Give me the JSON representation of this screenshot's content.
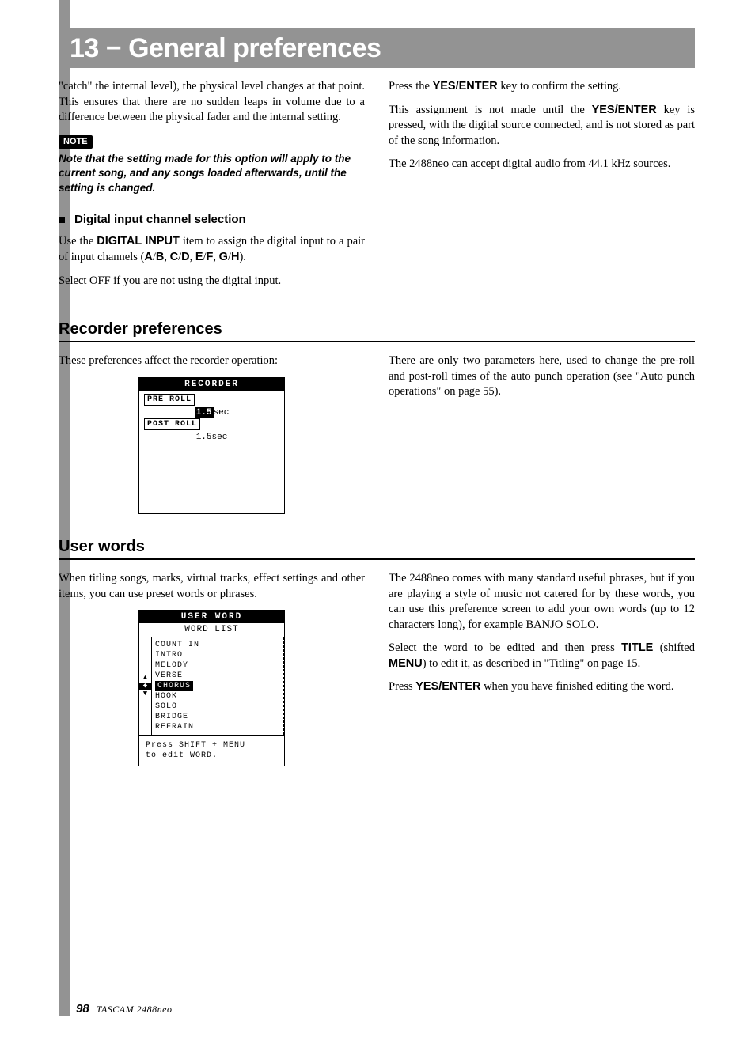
{
  "header": {
    "title": "13 − General preferences"
  },
  "leftcol": {
    "intro_p": "\"catch\" the internal level), the physical level changes at that point. This ensures that there are no sudden leaps in volume due to a difference between the physical fader and the internal setting.",
    "note_label": "NOTE",
    "note_body": "Note that the setting made for this option will apply to the current song, and any songs loaded afterwards, until the setting is changed.",
    "digital_head": "Digital input channel selection",
    "digital_p1a": "Use the ",
    "digital_p1b": "DIGITAL INPUT",
    "digital_p1c": " item to assign the digital input to a pair of input channels (",
    "digital_p1d": "A",
    "digital_p1e": "/",
    "digital_p1f": "B",
    "digital_p1g": ", ",
    "digital_p1h": "C",
    "digital_p1i": "/",
    "digital_p1j": "D",
    "digital_p1k": ", ",
    "digital_p1l": "E",
    "digital_p1m": "/",
    "digital_p1n": "F",
    "digital_p1o": ", ",
    "digital_p1p": "G",
    "digital_p1q": "/",
    "digital_p1r": "H",
    "digital_p1s": ").",
    "digital_p2": "Select OFF if you are not using the digital input."
  },
  "rightcol": {
    "p1a": "Press the ",
    "p1b": "YES/ENTER",
    "p1c": " key to confirm the setting.",
    "p2a": "This assignment is not made until the ",
    "p2b": "YES/ENTER",
    "p2c": " key is pressed, with the digital source connected, and is not stored as part of the song information.",
    "p3": "The 2488neo can accept digital audio from 44.1 kHz sources."
  },
  "recorder": {
    "heading": "Recorder preferences",
    "left_intro": "These preferences affect the recorder operation:",
    "right_p": "There are only two parameters here, used to change the pre-roll and post-roll times of the auto punch operation (see \"Auto punch operations\" on page 55).",
    "lcd": {
      "title": "RECORDER",
      "pre_label": "PRE ROLL",
      "pre_value_hi": "1.5",
      "pre_value_suffix": "sec",
      "post_label": "POST ROLL",
      "post_value": "1.5sec"
    }
  },
  "userwords": {
    "heading": "User words",
    "left_intro": "When titling songs, marks, virtual tracks, effect settings and other items, you can use preset words or phrases.",
    "right_p1": "The 2488neo comes with many standard useful phrases, but if you are playing a style of music not catered for by these words, you can use this preference screen to add your own words (up to 12 characters long), for example BANJO SOLO.",
    "right_p2a": "Select the word to be edited and then press ",
    "right_p2b": "TITLE",
    "right_p2c": " (shifted ",
    "right_p2d": "MENU",
    "right_p2e": ") to edit it, as described in \"Titling\" on page 15.",
    "right_p3a": "Press ",
    "right_p3b": "YES/ENTER",
    "right_p3c": " when you have finished editing the word.",
    "lcd": {
      "title": "USER WORD",
      "subtitle": "WORD LIST",
      "words": [
        "COUNT IN",
        "INTRO",
        "MELODY",
        "VERSE",
        "CHORUS",
        "HOOK",
        "SOLO",
        "BRIDGE",
        "REFRAIN"
      ],
      "selected_index": 4,
      "hint1": "Press SHIFT + MENU",
      "hint2": "to edit WORD."
    }
  },
  "footer": {
    "page": "98",
    "model": "TASCAM  2488neo"
  }
}
